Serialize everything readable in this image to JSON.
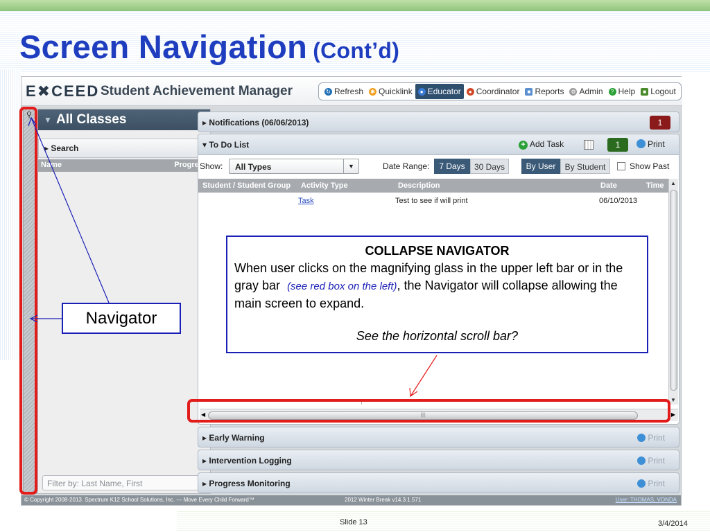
{
  "slide": {
    "title": "Screen Navigation",
    "subtitle": "(Cont’d)",
    "slide_number": "Slide 13",
    "date": "3/4/2014"
  },
  "app": {
    "logo": "E✖CEED",
    "name": "Student Achievement Manager",
    "nav": [
      {
        "label": "Refresh",
        "icon": "refresh-icon",
        "color": "#1f6fb5"
      },
      {
        "label": "Quicklink",
        "icon": "quicklink-star-icon",
        "color": "#f0a020"
      },
      {
        "label": "Educator",
        "icon": "educator-user-icon",
        "color": "#3a7bd5",
        "active": true
      },
      {
        "label": "Coordinator",
        "icon": "coordinator-user-icon",
        "color": "#d04a2a"
      },
      {
        "label": "Reports",
        "icon": "reports-icon",
        "color": "#5a8fd0"
      },
      {
        "label": "Admin",
        "icon": "admin-gear-icon",
        "color": "#9a9a9a"
      },
      {
        "label": "Help",
        "icon": "help-icon",
        "color": "#2aa036"
      },
      {
        "label": "Logout",
        "icon": "logout-icon",
        "color": "#4a8a2a"
      }
    ],
    "navigator": {
      "header": "All Classes",
      "search": "Search",
      "col_name": "Name",
      "col_progress": "Progress",
      "filter_placeholder": "Filter by: Last Name, First"
    },
    "panels": {
      "notifications": "Notifications (06/06/2013)",
      "notifications_count": "1",
      "todo_title": "To Do List",
      "add_task": "Add Task",
      "todo_count": "1",
      "print": "Print",
      "show_label": "Show:",
      "show_value": "All Types",
      "date_range_label": "Date Range:",
      "range_7": "7 Days",
      "range_30": "30 Days",
      "by_user": "By User",
      "by_student": "By Student",
      "show_past": "Show Past",
      "columns": [
        "Student / Student Group",
        "Activity Type",
        "Description",
        "Date",
        "Time"
      ],
      "rows": [
        {
          "student": "",
          "activity": "Task",
          "description": "Test to see if will print",
          "date": "06/10/2013",
          "time": ""
        }
      ],
      "early_warning": "Early Warning",
      "intervention_logging": "Intervention Logging",
      "progress_monitoring": "Progress Monitoring"
    },
    "footer": {
      "copyright": "© Copyright 2008-2013. Spectrum K12 School Solutions, Inc. ---  Move Every Child Forward™",
      "version": "2012 Winter Break v14.3.1.571",
      "user": "User: THOMAS, VONDA"
    }
  },
  "annotations": {
    "callout_title": "COLLAPSE NAVIGATOR",
    "callout_text_1": "When user clicks on the magnifying glass in the upper left bar or in the gray bar",
    "callout_note": "(see red box on the left)",
    "callout_text_2": ", the Navigator will collapse allowing the main screen to expand.",
    "callout_question": "See the horizontal scroll bar?",
    "navigator_label": "Navigator",
    "highlight_color": "#e21b1b",
    "callout_color": "#1a1fb5"
  }
}
